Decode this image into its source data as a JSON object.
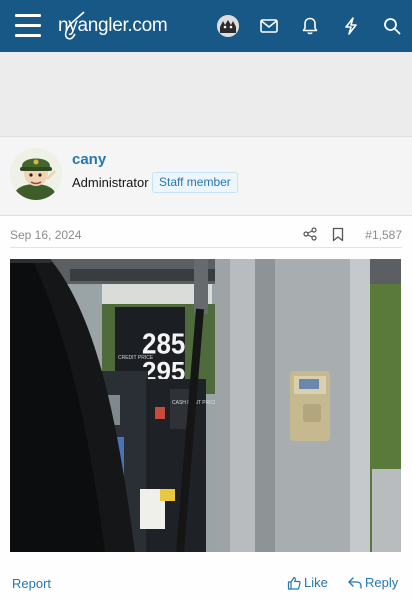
{
  "header": {
    "logo_text": "nyangler.com",
    "icons": [
      "menu-icon",
      "avatar",
      "inbox-icon",
      "bell-icon",
      "bolt-icon",
      "search-icon"
    ],
    "bg_color": "#185886"
  },
  "message": {
    "username": "cany",
    "user_title": "Administrator",
    "badge": "Staff member",
    "date": "Sep 16, 2024",
    "post_number": "#1,587",
    "image_description_icon": "photo",
    "actions": {
      "report": "Report",
      "like": "Like",
      "reply": "Reply"
    }
  },
  "gas_sign": {
    "price_top": "285",
    "price_bottom": "295",
    "label_credit": "CREDIT PRICE",
    "label_cash": "CASH RENT PRICE"
  },
  "colors": {
    "link": "#2577b1",
    "muted": "#8c8c8c"
  }
}
